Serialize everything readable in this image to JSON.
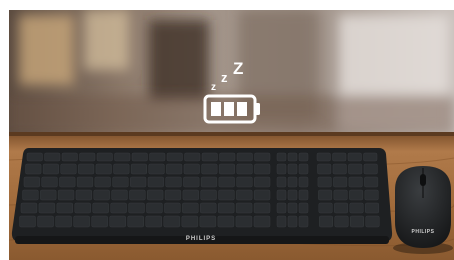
{
  "banner": {
    "title_fragment": "",
    "title_color": "#1a73d9"
  },
  "photo": {
    "subject": "keyboard-and-mouse-on-desk",
    "icons": [
      "sleep-zzz-icon",
      "battery-icon"
    ],
    "keyboard_brand": "PHILIPS",
    "mouse_brand": "PHILIPS",
    "colors": {
      "keyboard": "#1e2022",
      "keys": "#2b2e31",
      "desk": "#a16a3c",
      "icon": "#ffffff"
    }
  }
}
